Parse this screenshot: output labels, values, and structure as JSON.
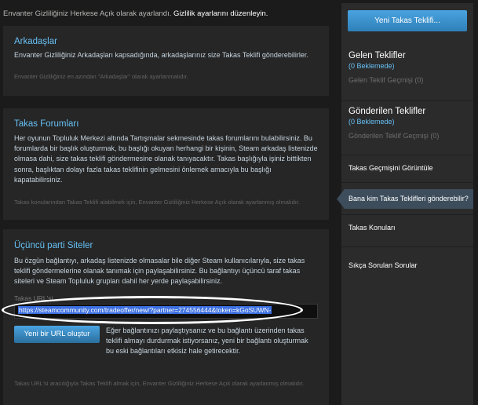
{
  "top_notice": {
    "text": "Envanter Gizliliğiniz Herkese Açık olarak ayarlandı.",
    "link": "Gizlilik ayarlarını düzenleyin."
  },
  "friends_panel": {
    "title": "Arkadaşlar",
    "body": "Envanter Gizliliğiniz Arkadaşları kapsadığında, arkadaşlarınız size Takas Teklifi gönderebilirler.",
    "footnote": "Envanter Gizliliğiniz en azından \"Arkadaşlar\" olarak ayarlanmalıdır."
  },
  "forums_panel": {
    "title": "Takas Forumları",
    "body": "Her oyunun Topluluk Merkezi altında Tartışmalar sekmesinde takas forumlarını bulabilirsiniz. Bu forumlarda bir başlık oluşturmak, bu başlığı okuyan herhangi bir kişinin, Steam arkadaş listenizde olmasa dahi, size takas teklifi göndermesine olanak tanıyacaktır. Takas başlığıyla işiniz bittikten sonra, başlıktan dolayı fazla takas teklifinin gelmesini önlemek amacıyla bu başlığı kapatabilirsiniz.",
    "footnote": "Takas konularından Takas Teklifi alabilmek için, Envanter Gizliliğiniz Herkese Açık olarak ayarlanmış olmalıdır."
  },
  "third_party_panel": {
    "title": "Üçüncü parti Siteler",
    "body": "Bu özgün bağlantıyı, arkadaş listenizde olmasalar bile diğer Steam kullanıcılarıyla, size takas teklifi göndermelerine olanak tanımak için paylaşabilirsiniz. Bu bağlantıyı üçüncü taraf takas siteleri ve Steam Topluluk grupları dahil her yerde paylaşabilirsiniz.",
    "url_label": "Takas URL'si",
    "url_value": "https://steamcommunity.com/tradeoffer/new/?partner=274556444&token=kGoSUWN-",
    "new_url_button": "Yeni bir URL oluştur",
    "new_url_note": "Eğer bağlantınızı paylaştıysanız ve bu bağlantı üzerinden takas teklifi almayı durdurmak istiyorsanız, yeni bir bağlantı oluşturmak bu eski bağlantıları etkisiz hale getirecektir.",
    "footnote": "Takas URL'si aracılığıyla Takas Teklifi almak için, Envanter Gizliliğiniz Herkese Açık olarak ayarlanmış olmalıdır."
  },
  "sidebar": {
    "new_offer_button": "Yeni Takas Teklifi...",
    "incoming": {
      "title": "Gelen Teklifler",
      "pending": "(0 Beklemede)",
      "history": "Gelen Teklif Geçmişi (0)"
    },
    "outgoing": {
      "title": "Gönderilen Teklifler",
      "pending": "(0 Beklemede)",
      "history": "Gönderilen Teklif Geçmişi (0)"
    },
    "links": {
      "history": "Takas Geçmişini Görüntüle",
      "who_can_send": "Bana kim Takas Teklifleri gönderebilir?",
      "topics": "Takas Konuları",
      "faq": "Sıkça Sorulan Sorular"
    }
  }
}
